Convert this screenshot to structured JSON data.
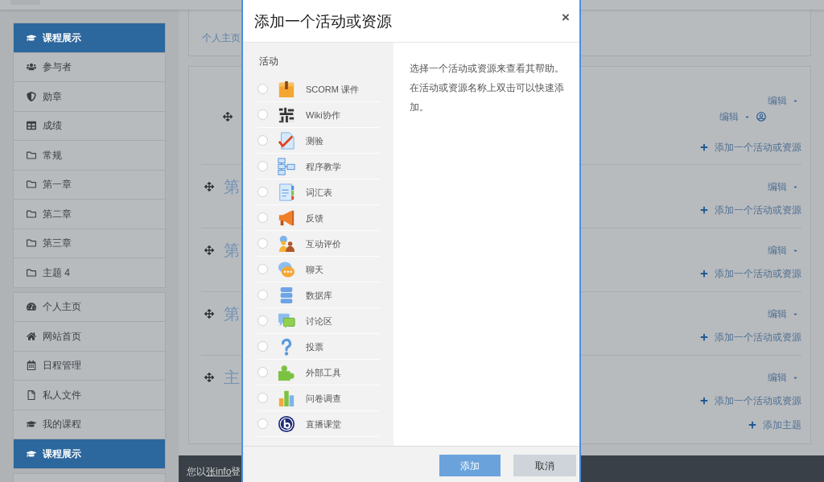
{
  "sidebar": {
    "groups": [
      [
        {
          "kind": "course",
          "label": "课程展示",
          "selected": true
        },
        {
          "kind": "participants",
          "label": "参与者",
          "selected": false
        },
        {
          "kind": "badges",
          "label": "勋章",
          "selected": false
        },
        {
          "kind": "grades",
          "label": "成绩",
          "selected": false
        },
        {
          "kind": "section",
          "label": "常规",
          "selected": false
        },
        {
          "kind": "section",
          "label": "第一章",
          "selected": false
        },
        {
          "kind": "section",
          "label": "第二章",
          "selected": false
        },
        {
          "kind": "section",
          "label": "第三章",
          "selected": false
        },
        {
          "kind": "section",
          "label": "主题 4",
          "selected": false
        }
      ],
      [
        {
          "kind": "dashboard",
          "label": "个人主页",
          "selected": false
        },
        {
          "kind": "home",
          "label": "网站首页",
          "selected": false
        },
        {
          "kind": "calendar",
          "label": "日程管理",
          "selected": false
        },
        {
          "kind": "files",
          "label": "私人文件",
          "selected": false
        },
        {
          "kind": "mycourses",
          "label": "我的课程",
          "selected": false
        },
        {
          "kind": "course",
          "label": "课程展示",
          "selected": true
        }
      ]
    ]
  },
  "course": {
    "breadcrumb": "个人主页",
    "sections": [
      {
        "edit": "编辑",
        "activities": [
          {
            "edit": "编辑"
          }
        ],
        "add": "添加一个活动或资源"
      },
      {
        "title": "第",
        "edit": "编辑",
        "add": "添加一个活动或资源"
      },
      {
        "title": "第",
        "edit": "编辑",
        "add": "添加一个活动或资源"
      },
      {
        "title": "第",
        "edit": "编辑",
        "add": "添加一个活动或资源"
      },
      {
        "title": "主",
        "edit": "编辑",
        "add": "添加一个活动或资源"
      }
    ],
    "add_topic": "添加主题"
  },
  "footer": {
    "before": "您以",
    "link": "张info",
    "after": "登"
  },
  "modal": {
    "title": "添加一个活动或资源",
    "close": "×",
    "group_label": "活动",
    "items": [
      {
        "kind": "scorm",
        "label": "SCORM 课件",
        "selected": false
      },
      {
        "kind": "wiki",
        "label": "Wiki协作",
        "selected": false
      },
      {
        "kind": "quiz",
        "label": "测验",
        "selected": false
      },
      {
        "kind": "lesson",
        "label": "程序教学",
        "selected": false
      },
      {
        "kind": "glossary",
        "label": "词汇表",
        "selected": false
      },
      {
        "kind": "feedback",
        "label": "反馈",
        "selected": false
      },
      {
        "kind": "workshop",
        "label": "互动评价",
        "selected": false
      },
      {
        "kind": "chat",
        "label": "聊天",
        "selected": false
      },
      {
        "kind": "data",
        "label": "数据库",
        "selected": false
      },
      {
        "kind": "forum",
        "label": "讨论区",
        "selected": false
      },
      {
        "kind": "choice",
        "label": "投票",
        "selected": false
      },
      {
        "kind": "lti",
        "label": "外部工具",
        "selected": false
      },
      {
        "kind": "questionnaire",
        "label": "问卷调查",
        "selected": false
      },
      {
        "kind": "bigbluebutton",
        "label": "直播课堂",
        "selected": false
      }
    ],
    "help": "选择一个活动或资源来查看其帮助。在活动或资源名称上双击可以快速添加。",
    "buttons": [
      {
        "kind": "primary",
        "label": "添加"
      },
      {
        "kind": "secondary",
        "label": "取消"
      }
    ]
  }
}
